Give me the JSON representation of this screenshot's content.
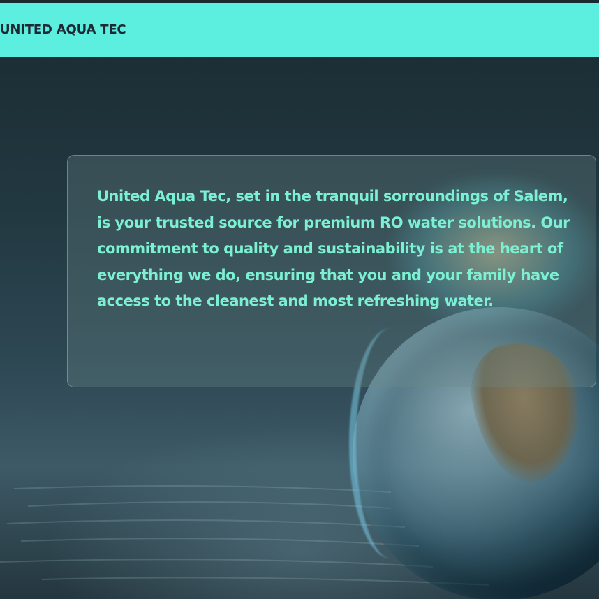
{
  "header": {
    "brand": "UNITED AQUA TEC"
  },
  "hero": {
    "description": "United Aqua Tec, set in the tranquil sorroundings of Salem, is your trusted source for premium RO water solutions. Our commitment to quality and sustainability is at the heart of everything we do, ensuring that you and your family have access to the cleanest and most refreshing water."
  },
  "colors": {
    "header_background": "#5cefe0",
    "brand_text": "#1d2a35",
    "hero_text": "#7cf0d2",
    "page_background": "#223841"
  }
}
